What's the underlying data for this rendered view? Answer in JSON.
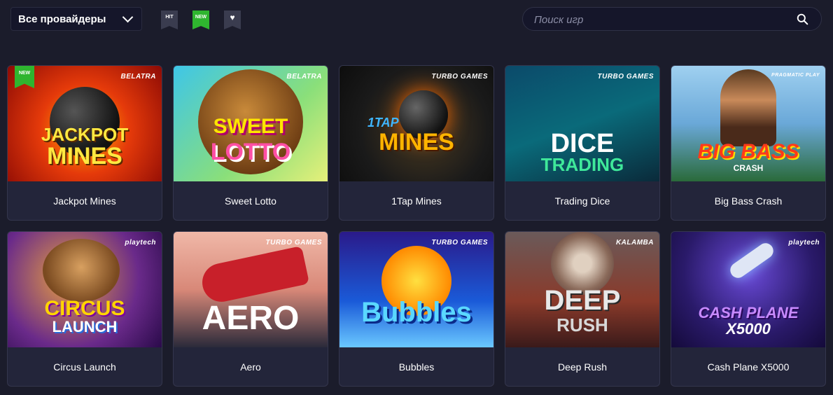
{
  "filters": {
    "provider_label": "Все провайдеры",
    "tags": {
      "hit": "HIT",
      "new": "NEW"
    }
  },
  "search": {
    "placeholder": "Поиск игр"
  },
  "games": [
    {
      "name": "Jackpot Mines",
      "provider": "BELATRA",
      "badge": "NEW",
      "art": [
        "JACKPOT",
        "MINES"
      ]
    },
    {
      "name": "Sweet Lotto",
      "provider": "BELATRA",
      "art": [
        "SWEET",
        "LOTTO"
      ]
    },
    {
      "name": "1Tap Mines",
      "provider": "TURBO GAMES",
      "art": [
        "1TAP",
        "MINES"
      ]
    },
    {
      "name": "Trading Dice",
      "provider": "TURBO GAMES",
      "art": [
        "DICE",
        "TRADING"
      ]
    },
    {
      "name": "Big Bass Crash",
      "provider": "PRAGMATIC PLAY",
      "art": [
        "BIG BASS",
        "CRASH"
      ]
    },
    {
      "name": "Circus Launch",
      "provider": "playtech",
      "art": [
        "CIRCUS",
        "LAUNCH"
      ]
    },
    {
      "name": "Aero",
      "provider": "TURBO GAMES",
      "art": [
        "AERO"
      ]
    },
    {
      "name": "Bubbles",
      "provider": "TURBO GAMES",
      "art": [
        "Bubbles"
      ]
    },
    {
      "name": "Deep Rush",
      "provider": "KALAMBA",
      "art": [
        "DEEP",
        "RUSH"
      ]
    },
    {
      "name": "Cash Plane X5000",
      "provider": "playtech",
      "art": [
        "CASH PLANE",
        "X5000"
      ]
    }
  ]
}
